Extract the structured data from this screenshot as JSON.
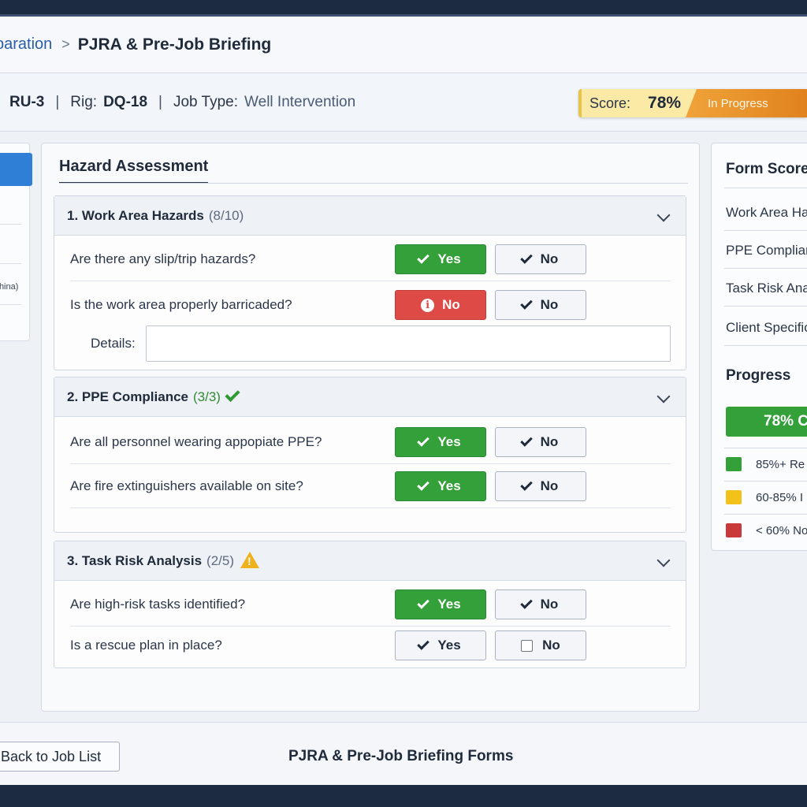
{
  "breadcrumb": {
    "previous": "paration",
    "current": "PJRA & Pre-Job Briefing"
  },
  "job": {
    "unit_value": "RU-3",
    "rig_label": "Rig:",
    "rig_value": "DQ-18",
    "job_type_label": "Job Type:",
    "job_type_value": "Well Intervention"
  },
  "score": {
    "label": "Score:",
    "value": "78%",
    "status": "In Progress"
  },
  "left_panel": {
    "partial_text": "China)"
  },
  "main": {
    "title": "Hazard Assessment",
    "sections": [
      {
        "title": "1. Work Area Hazards",
        "count": "(8/10)",
        "questions": [
          {
            "text": "Are there any slip/trip hazards?",
            "answer_a": "Yes",
            "answer_b": "No"
          },
          {
            "text": "Is the work area properly barricaded?",
            "answer_a": "No",
            "answer_b": "No"
          }
        ],
        "details_label": "Details:",
        "details_value": ""
      },
      {
        "title": "2. PPE Compliance",
        "count": "(3/3)",
        "questions": [
          {
            "text": "Are all personnel wearing appopiate PPE?",
            "answer_a": "Yes",
            "answer_b": "No"
          },
          {
            "text": "Are fire extinguishers available on site?",
            "answer_a": "Yes",
            "answer_b": "No"
          }
        ]
      },
      {
        "title": "3. Task Risk Analysis",
        "count": "(2/5)",
        "questions": [
          {
            "text": "Are high-risk tasks identified?",
            "answer_a": "Yes",
            "answer_b": "No"
          },
          {
            "text": "Is a rescue plan in place?",
            "answer_a": "Yes",
            "answer_b": "No"
          }
        ]
      }
    ]
  },
  "right_panel": {
    "title": "Form Score",
    "items": [
      "Work Area Ha",
      "PPE Complian",
      "Task Risk Ana",
      "Client Specific"
    ],
    "progress_title": "Progress",
    "progress_value": "78% C",
    "progress_fraction": 0.78,
    "legend": [
      {
        "label": "85%+ Re",
        "color": "#33a03a"
      },
      {
        "label": "60-85% I",
        "color": "#f2c21b"
      },
      {
        "label": "< 60% No",
        "color": "#c9383a"
      }
    ]
  },
  "footer": {
    "back_label": "Back to Job List",
    "title": "PJRA & Pre-Job Briefing Forms"
  },
  "colors": {
    "accent_blue": "#2f7fd6",
    "yes_green": "#33a03a",
    "no_red": "#de4a45",
    "status_orange": "#e0821d"
  }
}
